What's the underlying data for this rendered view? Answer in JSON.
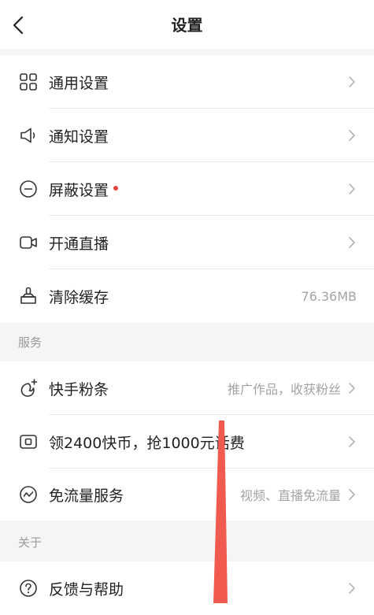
{
  "header": {
    "title": "设置"
  },
  "general": {
    "items": [
      {
        "icon": "grid-icon",
        "label": "通用设置",
        "value": ""
      },
      {
        "icon": "speaker-icon",
        "label": "通知设置",
        "value": ""
      },
      {
        "icon": "minus-circle-icon",
        "label": "屏蔽设置",
        "value": "",
        "badge_color": "#e5443b"
      },
      {
        "icon": "video-camera-icon",
        "label": "开通直播",
        "value": ""
      },
      {
        "icon": "broom-icon",
        "label": "清除缓存",
        "value": "76.36MB"
      }
    ]
  },
  "services": {
    "title": "服务",
    "items": [
      {
        "icon": "fan-tiao-icon",
        "label": "快手粉条",
        "value": "推广作品，收获粉丝"
      },
      {
        "icon": "coin-card-icon",
        "label": "领2400快币，抢1000元话费",
        "value": ""
      },
      {
        "icon": "data-wave-icon",
        "label": "免流量服务",
        "value": "视频、直播免流量"
      }
    ]
  },
  "about": {
    "title": "关于",
    "items": [
      {
        "icon": "help-circle-icon",
        "label": "反馈与帮助",
        "value": ""
      }
    ]
  },
  "colors": {
    "background": "#f5f5f5",
    "surface": "#ffffff",
    "text": "#222222",
    "secondary_text": "#a3a3a3",
    "badge": "#e5443b",
    "swipe_overlay": "#f05a4f"
  }
}
